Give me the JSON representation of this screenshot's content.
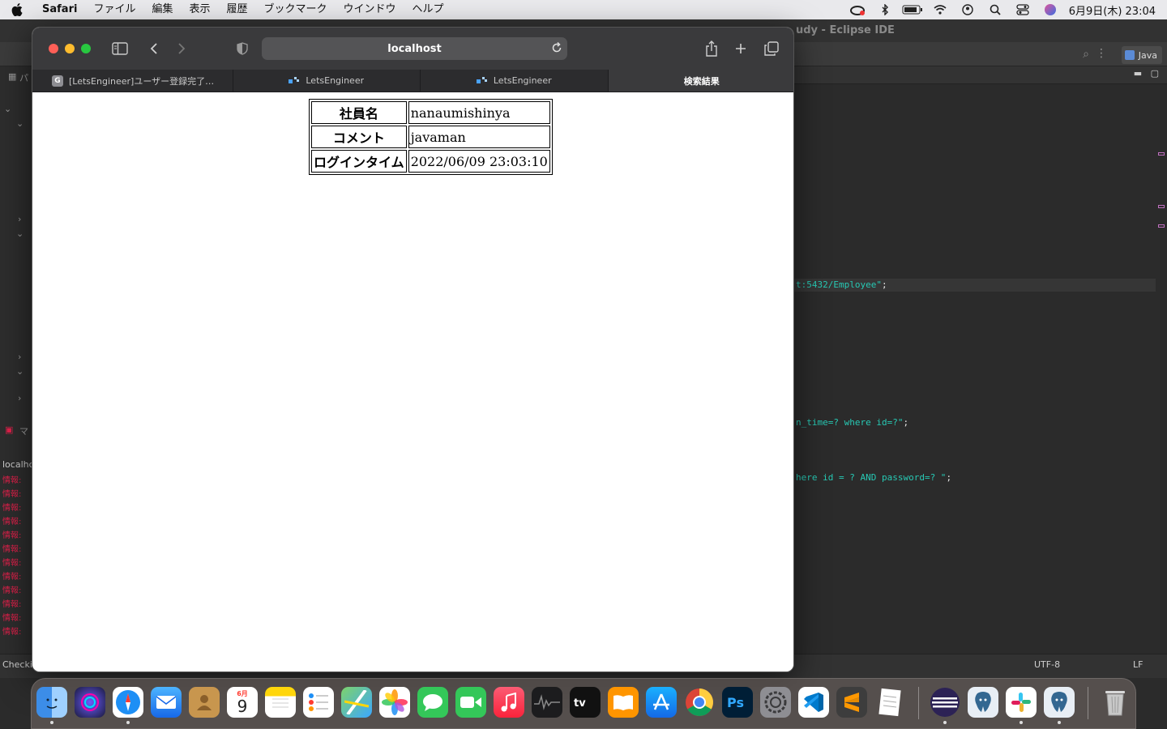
{
  "menubar": {
    "app_name": "Safari",
    "items": [
      "ファイル",
      "編集",
      "表示",
      "履歴",
      "ブックマーク",
      "ウインドウ",
      "ヘルプ"
    ],
    "clock": "6月9日(木)  23:04"
  },
  "eclipse": {
    "title": "udy  - Eclipse IDE",
    "perspective": "Java",
    "code_lines": [
      {
        "text": "t:5432/Employee\"",
        "tail": ";"
      },
      {
        "text": "n_time=? where id=?\"",
        "tail": ";"
      },
      {
        "text": "here id = ? AND password=? \"",
        "tail": ";"
      }
    ],
    "left_panel": {
      "tab_label": "パ",
      "console_tab_label": "マ",
      "console_label": "localhc",
      "console_lines": [
        "情報:",
        "情報:",
        "情報:",
        "情報:",
        "情報:",
        "情報:",
        "情報:",
        "情報:",
        "情報:",
        "情報:",
        "情報:",
        "情報:"
      ]
    },
    "status": {
      "left": "Checki",
      "encoding": "UTF-8",
      "line_ending": "LF"
    }
  },
  "safari": {
    "url": "localhost",
    "tabs": [
      {
        "label": "[LetsEngineer]ユーザー登録完了…",
        "favicon": "G",
        "active": false
      },
      {
        "label": "LetsEngineer",
        "active": false
      },
      {
        "label": "LetsEngineer",
        "active": false
      },
      {
        "label": "検索結果",
        "active": true
      }
    ]
  },
  "result": {
    "rows": [
      {
        "header": "社員名",
        "value": "nanaumishinya"
      },
      {
        "header": "コメント",
        "value": "javaman"
      },
      {
        "header": "ログインタイム",
        "value": "2022/06/09 23:03:10"
      }
    ]
  },
  "dock": {
    "calendar_month": "6月",
    "calendar_day": "9"
  }
}
